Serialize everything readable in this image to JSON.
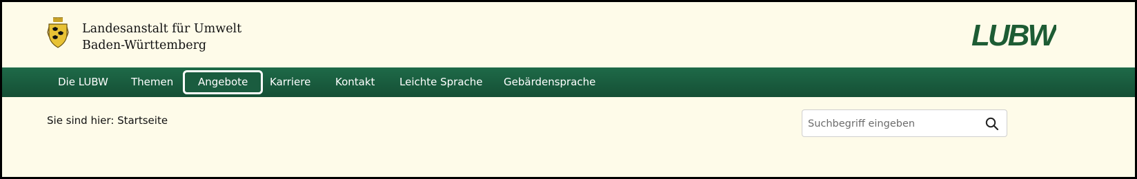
{
  "header": {
    "org_line1": "Landesanstalt für Umwelt",
    "org_line2": "Baden-Württemberg",
    "coat_icon": "coat-of-arms-icon",
    "logo_text": "LUBW",
    "logo_color": "#1d5c34"
  },
  "nav": {
    "background": "#1b5f40",
    "items": [
      {
        "label": "Die LUBW"
      },
      {
        "label": "Themen"
      },
      {
        "label": "Angebote",
        "active": true
      },
      {
        "label": "Karriere"
      },
      {
        "label": "Kontakt"
      },
      {
        "label": "Leichte Sprache"
      },
      {
        "label": "Gebärdensprache"
      }
    ]
  },
  "breadcrumb": {
    "text": "Sie sind hier: Startseite"
  },
  "search": {
    "placeholder": "Suchbegriff eingeben",
    "value": "",
    "icon": "search-icon"
  },
  "colors": {
    "page_background": "#fefbe9",
    "frame_border": "#000000",
    "nav_text": "#ffffff"
  }
}
